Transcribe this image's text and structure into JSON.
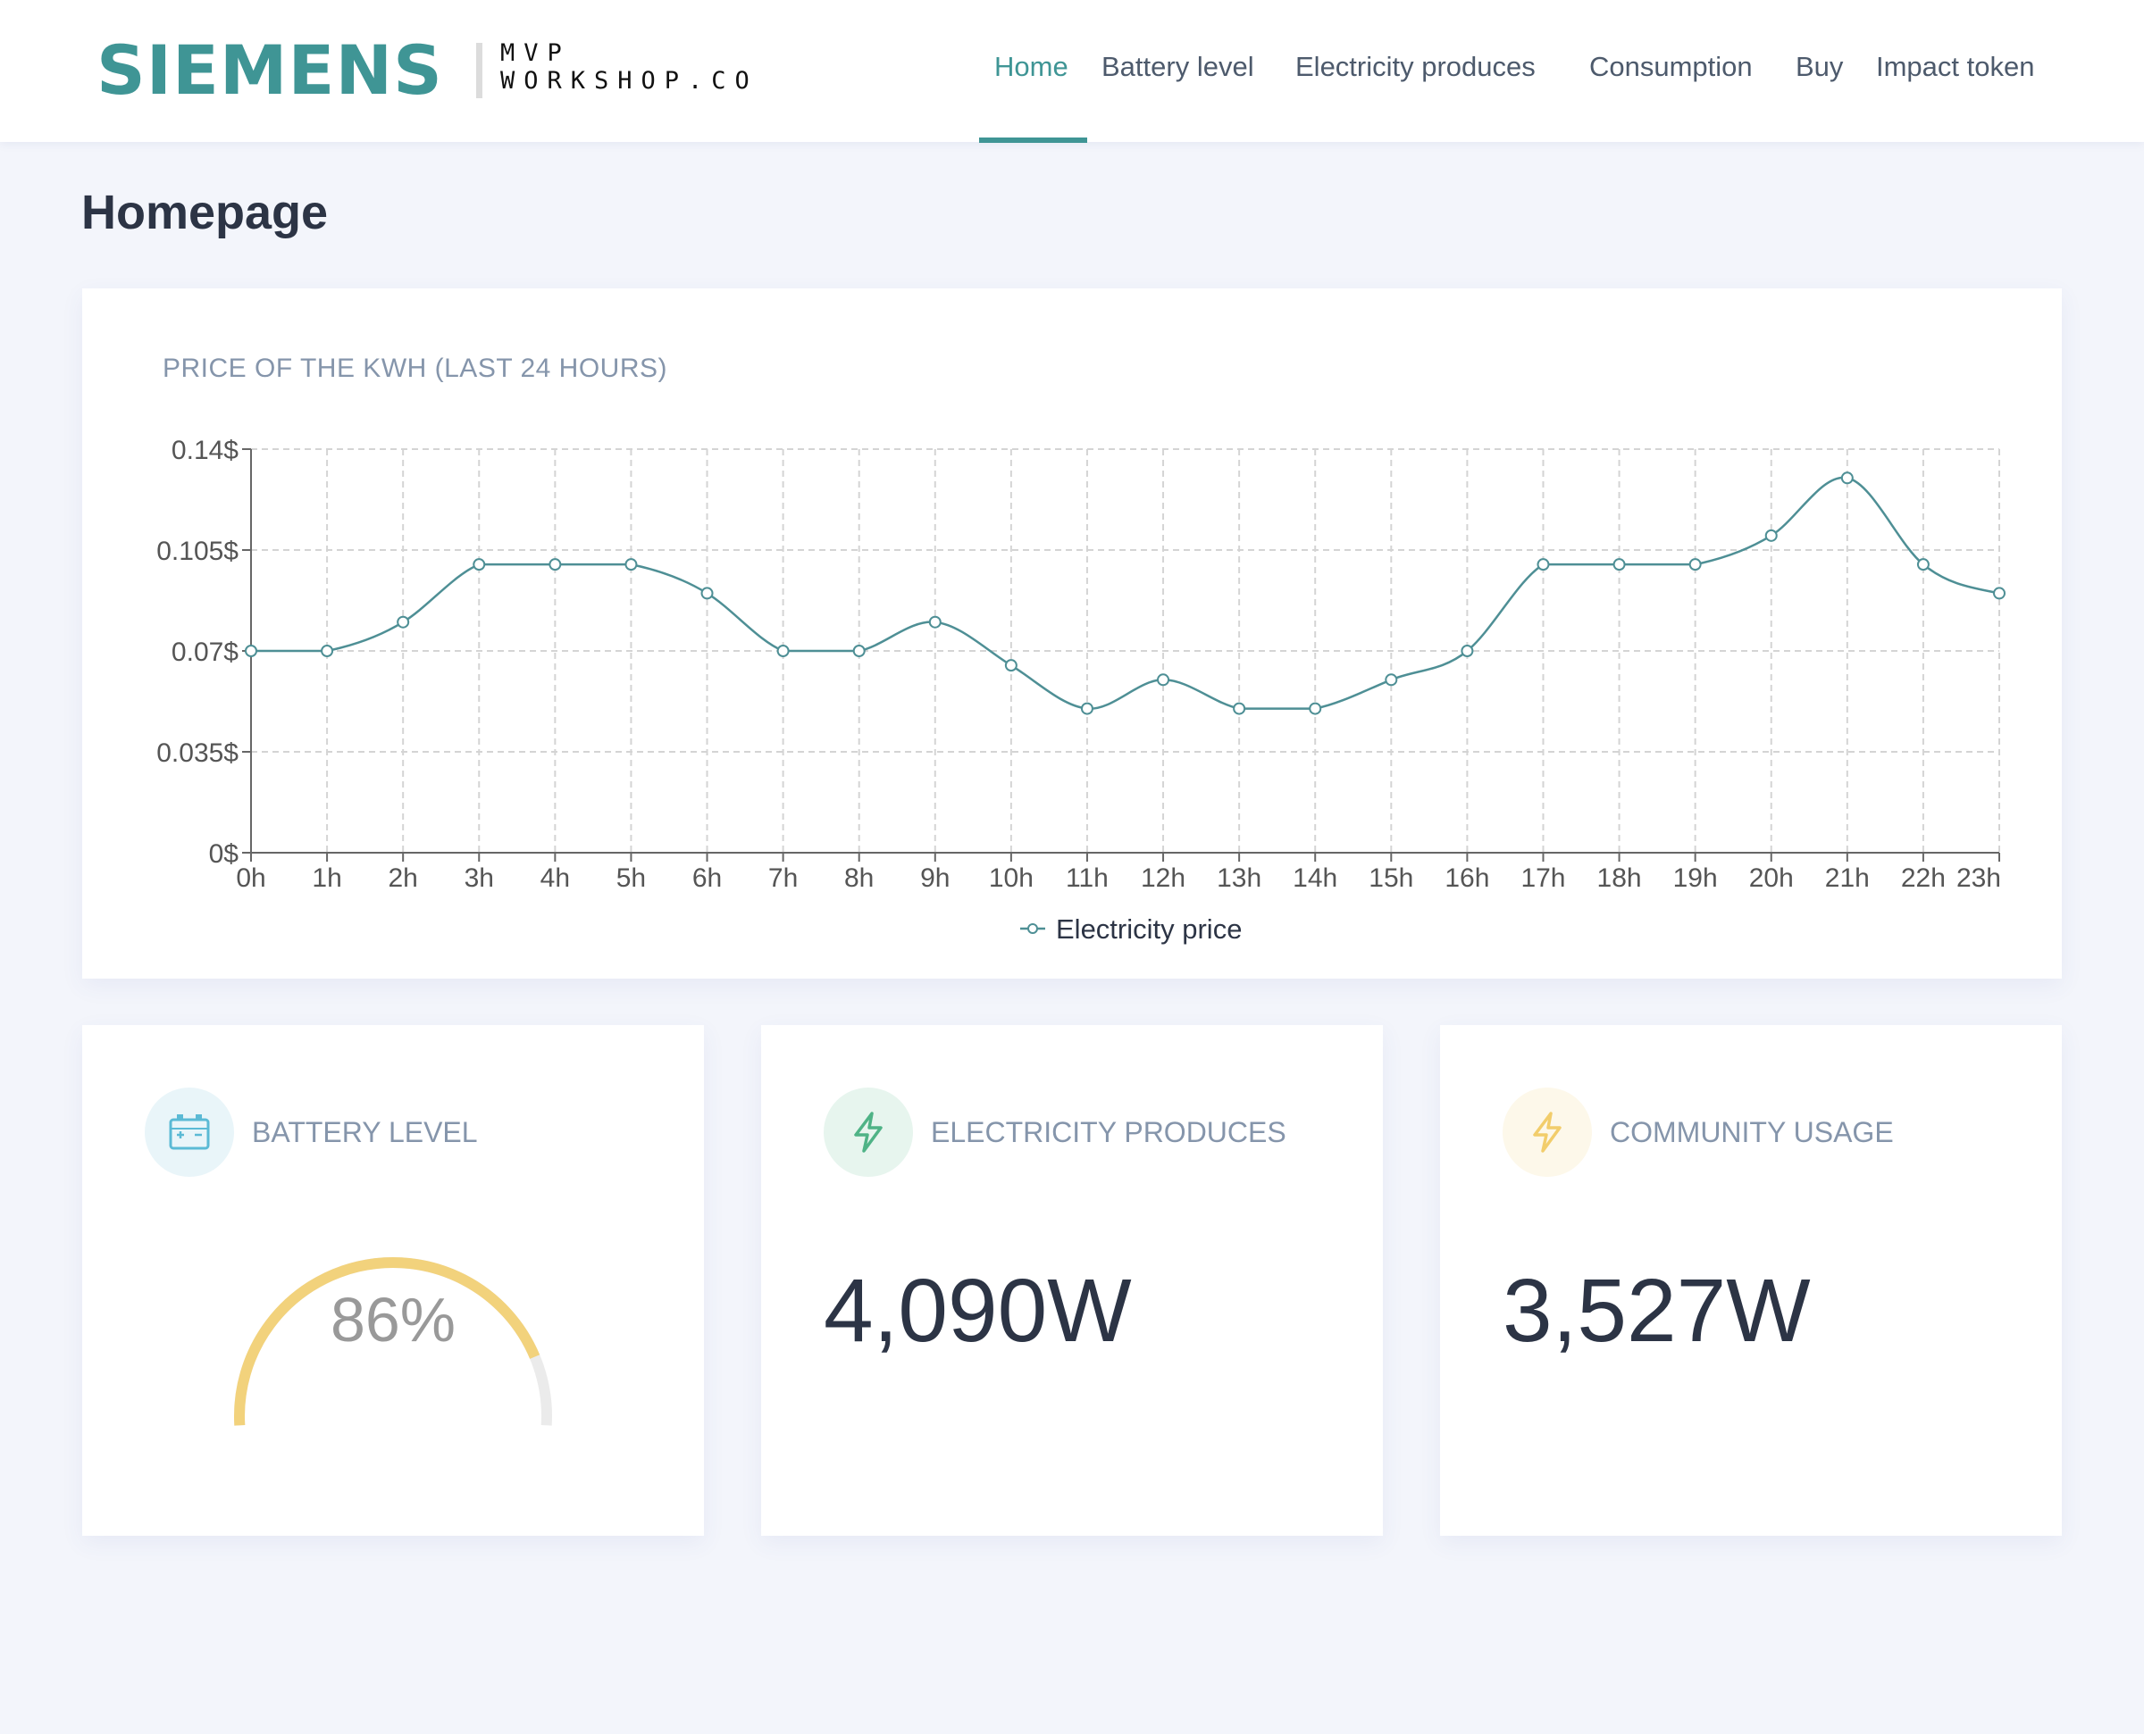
{
  "brand": {
    "siemens": "SIEMENS",
    "mvp_line1": "MVP",
    "mvp_line2": "WORKSHOP.CO",
    "accent_color": "#3f9595"
  },
  "nav": {
    "items": [
      {
        "label": "Home",
        "active": true
      },
      {
        "label": "Battery level",
        "active": false
      },
      {
        "label": "Electricity produces",
        "active": false
      },
      {
        "label": "Consumption",
        "active": false
      },
      {
        "label": "Buy",
        "active": false
      },
      {
        "label": "Impact token",
        "active": false
      }
    ]
  },
  "page": {
    "title": "Homepage"
  },
  "price_card": {
    "title": "PRICE OF THE KWH (LAST 24 HOURS)"
  },
  "chart_data": {
    "type": "line",
    "title": "PRICE OF THE KWH (LAST 24 HOURS)",
    "categories": [
      "0h",
      "1h",
      "2h",
      "3h",
      "4h",
      "5h",
      "6h",
      "7h",
      "8h",
      "9h",
      "10h",
      "11h",
      "12h",
      "13h",
      "14h",
      "15h",
      "16h",
      "17h",
      "18h",
      "19h",
      "20h",
      "21h",
      "22h",
      "23h"
    ],
    "series": [
      {
        "name": "Electricity price",
        "color": "#4e8f95",
        "values": [
          0.07,
          0.07,
          0.08,
          0.1,
          0.1,
          0.1,
          0.09,
          0.07,
          0.07,
          0.08,
          0.065,
          0.05,
          0.06,
          0.05,
          0.05,
          0.06,
          0.07,
          0.1,
          0.1,
          0.1,
          0.11,
          0.13,
          0.1,
          0.09
        ]
      }
    ],
    "yticks": [
      "0$",
      "0.035$",
      "0.07$",
      "0.105$",
      "0.14$"
    ],
    "ylim": [
      0,
      0.14
    ],
    "grid": true,
    "legend_position": "bottom"
  },
  "stats": {
    "battery": {
      "label": "BATTERY LEVEL",
      "value_text": "86%",
      "level": 0.86,
      "icon": "battery-icon",
      "color": "#f2d27c",
      "track_color": "#ebebeb",
      "icon_bg": "#e9f5f9",
      "icon_color": "#5bbad5"
    },
    "produces": {
      "label": "ELECTRICITY PRODUCES",
      "value": "4,090W",
      "icon": "lightning-icon",
      "icon_bg": "#e7f5ee",
      "icon_color": "#4fb386"
    },
    "usage": {
      "label": "COMMUNITY USAGE",
      "value": "3,527W",
      "icon": "lightning-icon",
      "icon_bg": "#fdf8ea",
      "icon_color": "#f2cd6b"
    }
  }
}
